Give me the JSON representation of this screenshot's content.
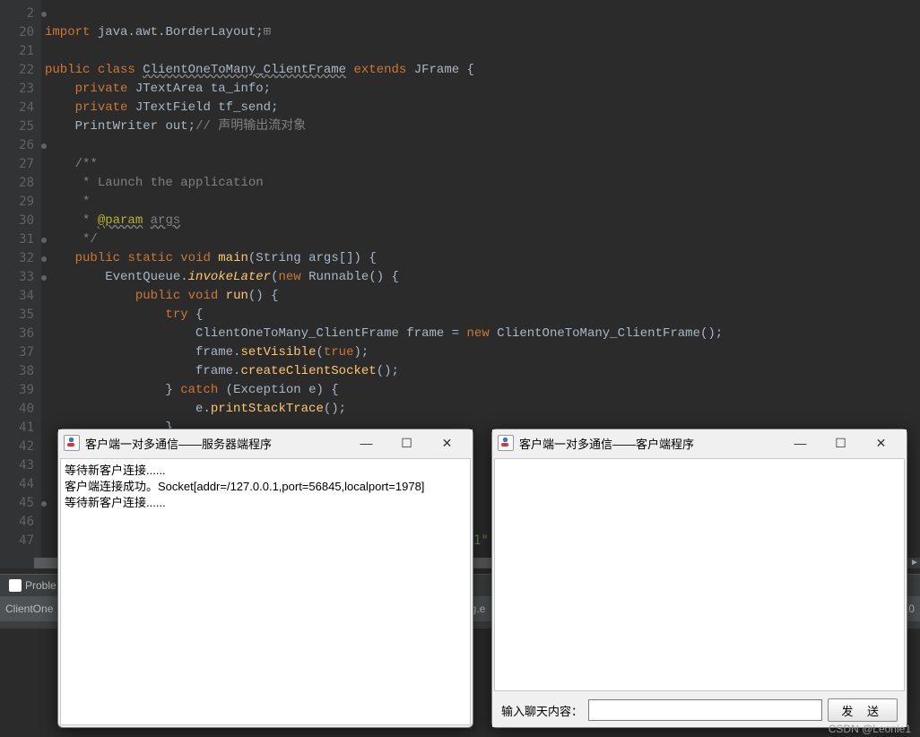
{
  "editor": {
    "lines": [
      {
        "n": 2,
        "mark": true
      },
      {
        "n": 20,
        "mark": false
      },
      {
        "n": 21,
        "mark": false
      },
      {
        "n": 22,
        "mark": false
      },
      {
        "n": 23,
        "mark": false
      },
      {
        "n": 24,
        "mark": false
      },
      {
        "n": 25,
        "mark": false
      },
      {
        "n": 26,
        "mark": true
      },
      {
        "n": 27,
        "mark": false
      },
      {
        "n": 28,
        "mark": false
      },
      {
        "n": 29,
        "mark": false
      },
      {
        "n": 30,
        "mark": false
      },
      {
        "n": 31,
        "mark": true
      },
      {
        "n": 32,
        "mark": true
      },
      {
        "n": 33,
        "mark": true
      },
      {
        "n": 34,
        "mark": false
      },
      {
        "n": 35,
        "mark": false
      },
      {
        "n": 36,
        "mark": false
      },
      {
        "n": 37,
        "mark": false
      },
      {
        "n": 38,
        "mark": false
      },
      {
        "n": 39,
        "mark": false
      },
      {
        "n": 40,
        "mark": false
      },
      {
        "n": 41,
        "mark": false
      },
      {
        "n": 42,
        "mark": false
      },
      {
        "n": 43,
        "mark": false
      },
      {
        "n": 44,
        "mark": false
      },
      {
        "n": 45,
        "mark": true
      },
      {
        "n": 46,
        "mark": false
      },
      {
        "n": 47,
        "mark": false
      }
    ],
    "tokens": {
      "import": "import",
      "pkg": "java.awt.BorderLayout",
      "public": "public",
      "class": "class",
      "className": "ClientOneToMany_ClientFrame",
      "extends": "extends",
      "JFrame": "JFrame",
      "private": "private",
      "JTextArea": "JTextArea",
      "ta_info": "ta_info",
      "JTextField": "JTextField",
      "tf_send": "tf_send",
      "PrintWriter": "PrintWriter",
      "out": "out",
      "commentOut": "// 声明输出流对象",
      "docStart": "/**",
      "docLine1": " * Launch the application",
      "docStar": " *",
      "docParam": "@param",
      "docArgs": "args",
      "docEnd": " */",
      "static": "static",
      "void": "void",
      "main": "main",
      "String": "String",
      "args": "args",
      "EventQueue": "EventQueue",
      "invokeLater": "invokeLater",
      "new": "new",
      "Runnable": "Runnable",
      "run": "run",
      "try": "try",
      "frameType": "ClientOneToMany_ClientFrame",
      "frame": "frame",
      "setVisible": "setVisible",
      "true": "true",
      "createClientSocket": "createClientSocket",
      "catch": "catch",
      "Exception": "Exception",
      "e": "e",
      "printStackTrace": "printStackTrace"
    },
    "visibleStringFragment": "1\""
  },
  "bottomPanel": {
    "tabLabel": "Proble",
    "statusLeft": "ClientOne",
    "statusMid": "g.e",
    "statusRight": "10"
  },
  "serverWindow": {
    "title": "客户端一对多通信——服务器端程序",
    "content": "等待新客户连接......\n客户端连接成功。Socket[addr=/127.0.0.1,port=56845,localport=1978]\n等待新客户连接......"
  },
  "clientWindow": {
    "title": "客户端一对多通信——客户端程序",
    "inputLabel": "输入聊天内容：",
    "placeholder": "",
    "sendButton": "发 送"
  },
  "watermark": "CSDN @Leonie1"
}
